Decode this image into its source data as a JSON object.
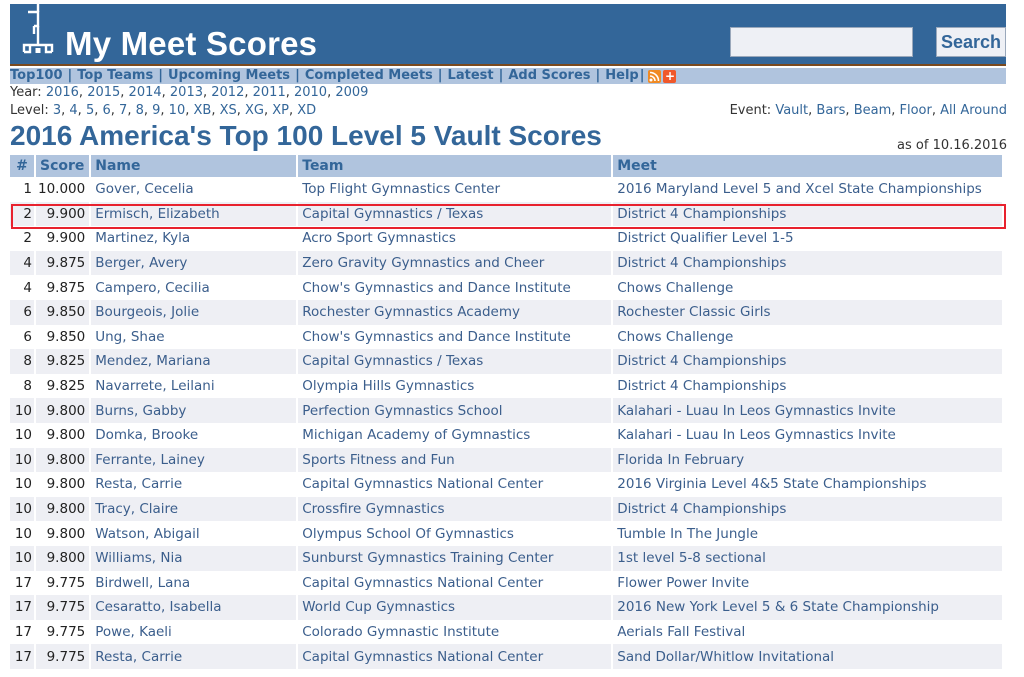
{
  "header": {
    "site_title": "My Meet Scores",
    "logo_icon": "bracket-tree-icon",
    "search": {
      "value": "",
      "placeholder": "",
      "button_label": "Search"
    }
  },
  "nav": {
    "items": [
      {
        "label": "Top100"
      },
      {
        "label": "Top Teams"
      },
      {
        "label": "Upcoming Meets"
      },
      {
        "label": "Completed Meets"
      },
      {
        "label": "Latest"
      },
      {
        "label": "Add Scores"
      },
      {
        "label": "Help"
      }
    ],
    "rss_icon": "rss-feed-icon",
    "add_icon": "plus-icon"
  },
  "filters": {
    "year_label": "Year:",
    "years": [
      "2016",
      "2015",
      "2014",
      "2013",
      "2012",
      "2011",
      "2010",
      "2009"
    ],
    "level_label": "Level:",
    "levels": [
      "3",
      "4",
      "5",
      "6",
      "7",
      "8",
      "9",
      "10",
      "XB",
      "XS",
      "XG",
      "XP",
      "XD"
    ],
    "event_label": "Event:",
    "events": [
      "Vault",
      "Bars",
      "Beam",
      "Floor",
      "All Around"
    ]
  },
  "page": {
    "title": "2016 America's Top 100 Level 5 Vault Scores",
    "as_of": "as of 10.16.2016"
  },
  "table": {
    "columns": [
      "#",
      "Score",
      "Name",
      "Team",
      "Meet"
    ],
    "highlighted_row_index": 1,
    "highlight_color": "#e8222e",
    "rows": [
      {
        "rank": "1",
        "score": "10.000",
        "name": "Gover, Cecelia",
        "team": "Top Flight Gymnastics Center",
        "meet": "2016 Maryland Level 5 and Xcel State Championships"
      },
      {
        "rank": "2",
        "score": "9.900",
        "name": "Ermisch, Elizabeth",
        "team": "Capital Gymnastics / Texas",
        "meet": "District 4 Championships"
      },
      {
        "rank": "2",
        "score": "9.900",
        "name": "Martinez, Kyla",
        "team": "Acro Sport Gymnastics",
        "meet": "District Qualifier Level 1-5"
      },
      {
        "rank": "4",
        "score": "9.875",
        "name": "Berger, Avery",
        "team": "Zero Gravity Gymnastics and Cheer",
        "meet": "District 4 Championships"
      },
      {
        "rank": "4",
        "score": "9.875",
        "name": "Campero, Cecilia",
        "team": "Chow's Gymnastics and Dance Institute",
        "meet": "Chows Challenge"
      },
      {
        "rank": "6",
        "score": "9.850",
        "name": "Bourgeois, Jolie",
        "team": "Rochester Gymnastics Academy",
        "meet": "Rochester Classic Girls"
      },
      {
        "rank": "6",
        "score": "9.850",
        "name": "Ung, Shae",
        "team": "Chow's Gymnastics and Dance Institute",
        "meet": "Chows Challenge"
      },
      {
        "rank": "8",
        "score": "9.825",
        "name": "Mendez, Mariana",
        "team": "Capital Gymnastics / Texas",
        "meet": "District 4 Championships"
      },
      {
        "rank": "8",
        "score": "9.825",
        "name": "Navarrete, Leilani",
        "team": "Olympia Hills Gymnastics",
        "meet": "District 4 Championships"
      },
      {
        "rank": "10",
        "score": "9.800",
        "name": "Burns, Gabby",
        "team": "Perfection Gymnastics School",
        "meet": "Kalahari - Luau In Leos Gymnastics Invite"
      },
      {
        "rank": "10",
        "score": "9.800",
        "name": "Domka, Brooke",
        "team": "Michigan Academy of Gymnastics",
        "meet": "Kalahari - Luau In Leos Gymnastics Invite"
      },
      {
        "rank": "10",
        "score": "9.800",
        "name": "Ferrante, Lainey",
        "team": "Sports Fitness and Fun",
        "meet": "Florida In February"
      },
      {
        "rank": "10",
        "score": "9.800",
        "name": "Resta, Carrie",
        "team": "Capital Gymnastics National Center",
        "meet": "2016 Virginia Level 4&5 State Championships"
      },
      {
        "rank": "10",
        "score": "9.800",
        "name": "Tracy, Claire",
        "team": "Crossfire Gymnastics",
        "meet": "District 4 Championships"
      },
      {
        "rank": "10",
        "score": "9.800",
        "name": "Watson, Abigail",
        "team": "Olympus School Of Gymnastics",
        "meet": "Tumble In The Jungle"
      },
      {
        "rank": "10",
        "score": "9.800",
        "name": "Williams, Nia",
        "team": "Sunburst Gymnastics Training Center",
        "meet": "1st level 5-8 sectional"
      },
      {
        "rank": "17",
        "score": "9.775",
        "name": "Birdwell, Lana",
        "team": "Capital Gymnastics National Center",
        "meet": "Flower Power Invite"
      },
      {
        "rank": "17",
        "score": "9.775",
        "name": "Cesaratto, Isabella",
        "team": "World Cup Gymnastics",
        "meet": "2016 New York Level 5 & 6 State Championship"
      },
      {
        "rank": "17",
        "score": "9.775",
        "name": "Powe, Kaeli",
        "team": "Colorado Gymnastic Institute",
        "meet": "Aerials Fall Festival"
      },
      {
        "rank": "17",
        "score": "9.775",
        "name": "Resta, Carrie",
        "team": "Capital Gymnastics National Center",
        "meet": "Sand Dollar/Whitlow Invitational"
      }
    ]
  }
}
